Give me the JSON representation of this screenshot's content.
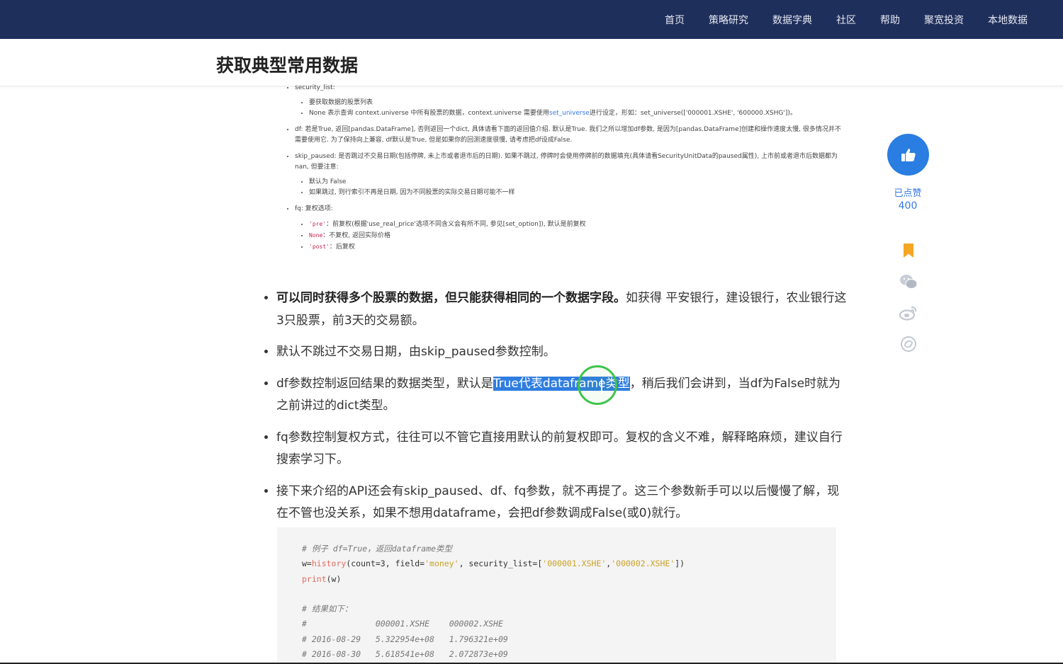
{
  "nav": {
    "items": [
      "首页",
      "策略研究",
      "数据字典",
      "社区",
      "帮助",
      "聚宽投资",
      "本地数据"
    ]
  },
  "page": {
    "title": "获取典型常用数据"
  },
  "embedded": {
    "security_list_label": "security_list:",
    "security_list_items": [
      "要获取数据的股票列表",
      "None 表示查询 context.universe 中所有股票的数据，context.universe 需要使用"
    ],
    "set_universe_link": "set_universe",
    "security_list_tail": "进行设定，形如：set_universe(['000001.XSHE', '600000.XSHG'])。",
    "df_text": "df: 若是True, 返回[pandas.DataFrame], 否则返回一个dict, 具体请看下面的返回值介绍. 默认是True. 我们之所以增加df参数, 是因为[pandas.DataFrame]创建和操作速度太慢, 很多情况并不需要使用它. 为了保持向上兼容, df默认是True, 但是如果你的回测速度很慢, 请考虑把df设成False.",
    "skip_paused_text": "skip_paused: 是否跳过不交易日期(包括停牌, 未上市或者退市后的日期). 如果不跳过, 停牌时会使用停牌前的数据填充(具体请看SecurityUnitData的paused属性), 上市前或者退市后数据都为 nan, 但要注意:",
    "skip_paused_items": [
      "默认为 False",
      "如果跳过, 则行索引不再是日期, 因为不同股票的实际交易日期可能不一样"
    ],
    "fq_label": "fq: 复权选项:",
    "fq_items": [
      {
        "code": "'pre'",
        "text": "：前复权(根据'use_real_price'选项不同含义会有所不同, 参见[set_option]), 默认是前复权"
      },
      {
        "code": "None",
        "text": "：不复权, 返回实际价格"
      },
      {
        "code": "'post'",
        "text": "：后复权"
      }
    ]
  },
  "main": {
    "item1_bold": "可以同时获得多个股票的数据，但只能获得相同的一个数据字段。",
    "item1_rest": "如获得 平安银行，建设银行，农业银行这3只股票，前3天的交易额。",
    "item2": "默认不跳过不交易日期，由skip_paused参数控制。",
    "item3_pre": "df参数控制返回结果的数据类型，默认是",
    "item3_highlight": "True代表dataframe类型",
    "item3_post": "，稍后我们会讲到，当df为False时就为之前讲过的dict类型。",
    "item4": "fq参数控制复权方式，往往可以不管它直接用默认的前复权即可。复权的含义不难，解释略麻烦，建议自行搜索学习下。",
    "item5": "接下来介绍的API还会有skip_paused、df、fq参数，就不再提了。这三个参数新手可以以后慢慢了解，现在不管也没关系，如果不想用dataframe，会把df参数调成False(或0)就行。"
  },
  "code": {
    "comment1": "# 例子 df=True，返回dataframe类型",
    "line2_a": "w=",
    "line2_fn": "history",
    "line2_b": "(count=3, field=",
    "line2_s1": "'money'",
    "line2_c": ", security_list=[",
    "line2_s2": "'000001.XSHE'",
    "line2_d": ",",
    "line2_s3": "'000002.XSHE'",
    "line2_e": "])",
    "line3_fn": "print",
    "line3_b": "(w)",
    "comment2": "# 结果如下：",
    "result_header": "#              000001.XSHE    000002.XSHE",
    "result_row1": "# 2016-08-29   5.322954e+08   1.796321e+09",
    "result_row2": "# 2016-08-30   5.618541e+08   2.072873e+09"
  },
  "sidebar": {
    "like_label": "已点赞",
    "like_count": "400",
    "icons": [
      "thumbs-up-icon",
      "bookmark-icon",
      "wechat-icon",
      "weibo-icon",
      "share-icon"
    ]
  },
  "colors": {
    "nav_bg": "#1f2f5c",
    "accent": "#2a7de1",
    "highlight": "#2f7de0",
    "click_ring": "#3fc44c",
    "bookmark": "#f5a623"
  }
}
